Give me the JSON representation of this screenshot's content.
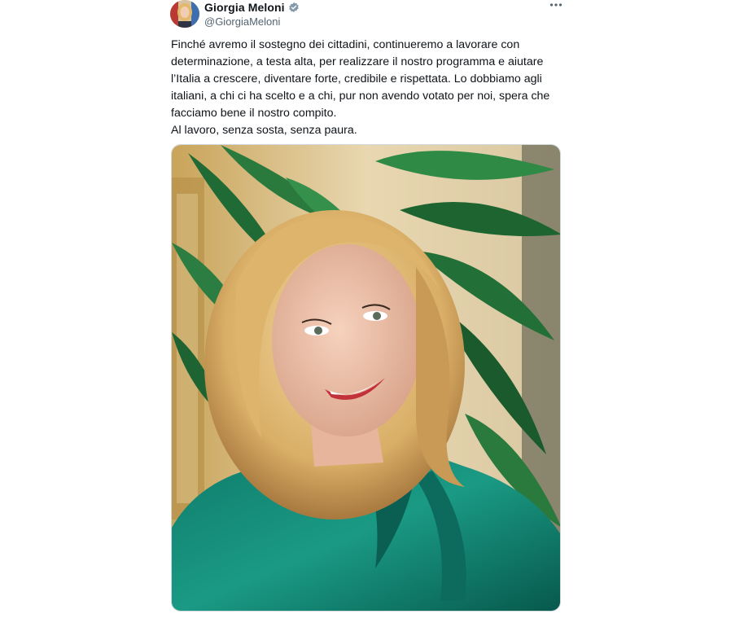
{
  "author": {
    "display_name": "Giorgia Meloni",
    "handle": "@GiorgiaMeloni",
    "verified": true,
    "avatar_icon": "profile-photo"
  },
  "tweet": {
    "text_main": "Finché avremo il sostegno dei cittadini, continueremo a lavorare con\ndeterminazione, a testa alta, per realizzare il nostro programma e aiutare\nl’Italia a crescere, diventare forte, credibile e rispettata. Lo dobbiamo agli\nitaliani, a chi ci ha scelto e a chi, pur non avendo votato per noi, spera che\nfacciamo bene il nostro compito.",
    "text_closing": "Al lavoro, senza sosta, senza paura."
  },
  "icons": {
    "more": "more-horizontal-icon",
    "verified": "verified-badge-icon"
  },
  "colors": {
    "text": "#0f1419",
    "secondary": "#536471",
    "verified": "#829aab",
    "border": "#cfd9de"
  }
}
